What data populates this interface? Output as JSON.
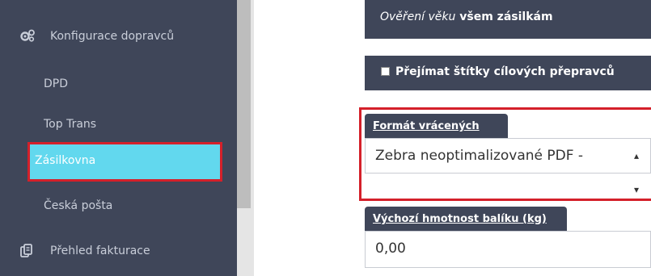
{
  "sidebar": {
    "section_title": "Konfigurace dopravců",
    "items": [
      {
        "label": "DPD"
      },
      {
        "label": "Top Trans"
      },
      {
        "label": "Zásilkovna",
        "active": true
      },
      {
        "label": "Česká pošta"
      }
    ],
    "billing_label": "Přehled fakturace"
  },
  "content": {
    "verify_italic": "Ověření věku",
    "verify_rest": " všem zásilkám",
    "adopt_label": "Přejímat štítky cílových přepravců",
    "adopt_checked": false,
    "return_format": {
      "label": "Formát vrácených štítků",
      "value": "Zebra neoptimalizované PDF -"
    },
    "default_weight": {
      "label": "Výchozí hmotnost balíku (kg)",
      "value": "0,00"
    }
  },
  "colors": {
    "sidebar_bg": "#3f4659",
    "active_bg": "#62d8ee",
    "highlight": "#d4202a"
  }
}
